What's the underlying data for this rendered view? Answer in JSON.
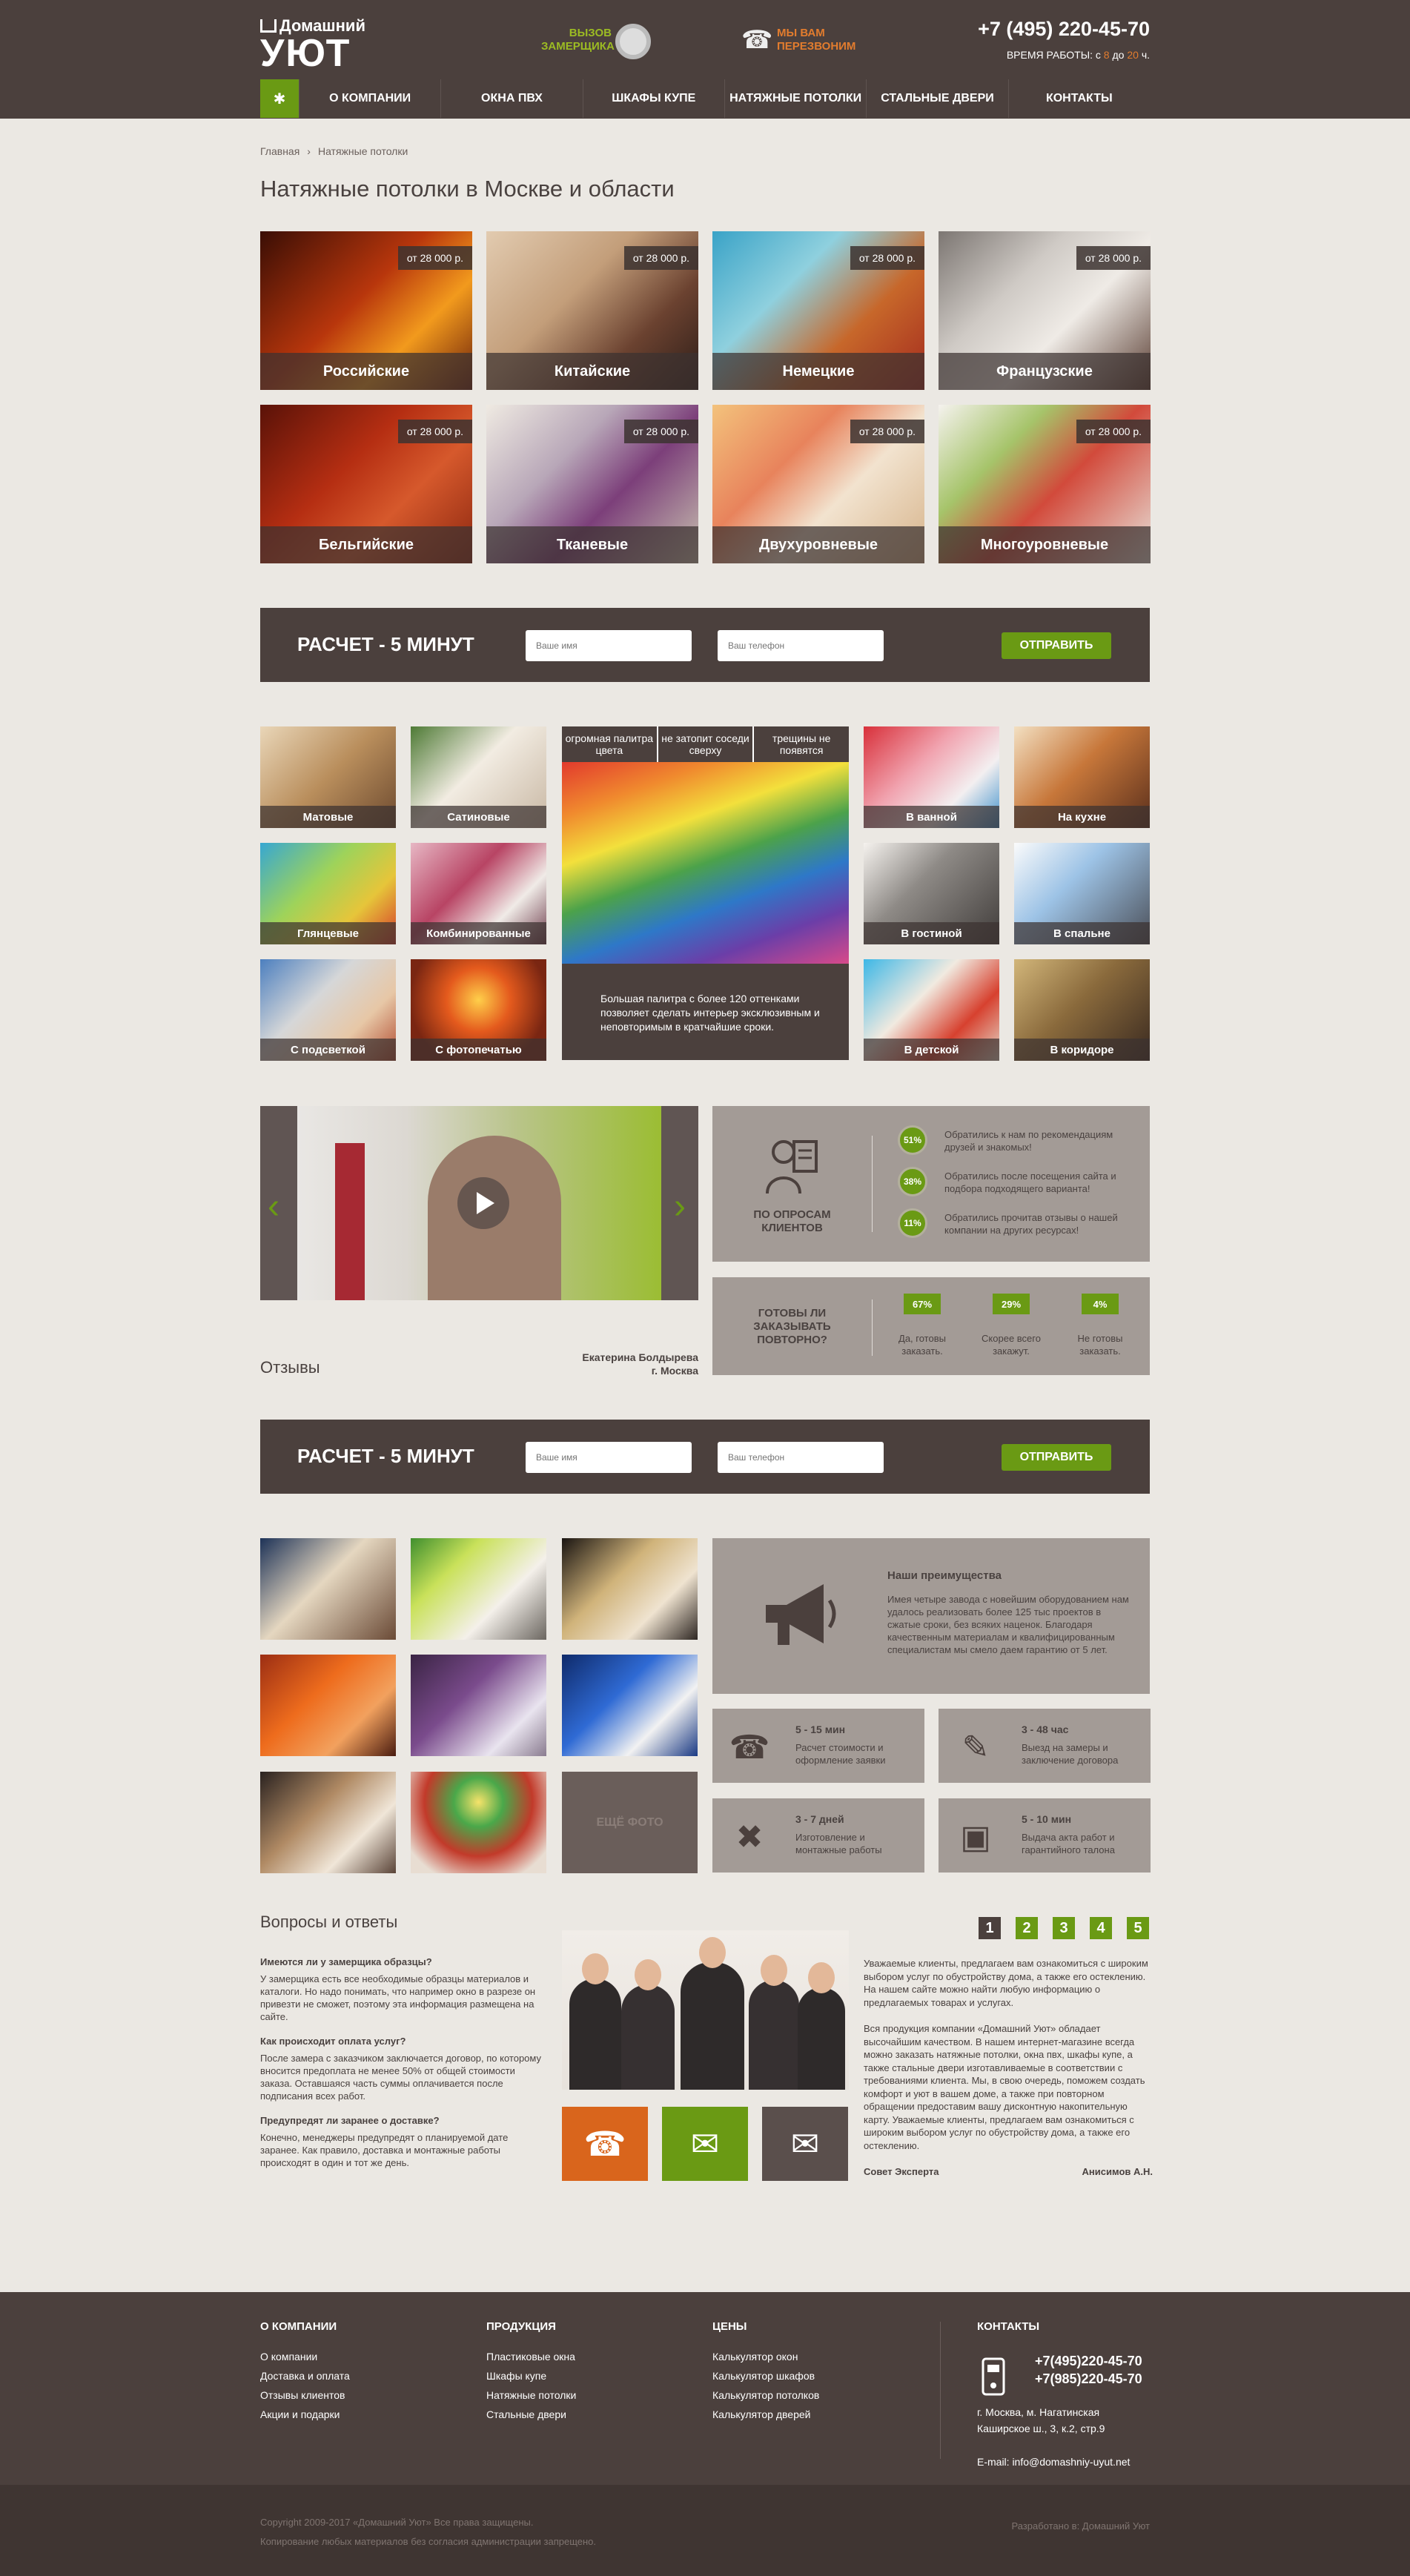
{
  "header": {
    "logo_small": "Домашний",
    "logo_big": "УЮТ",
    "measure_line1": "ВЫЗОВ",
    "measure_line2": "ЗАМЕРЩИКА",
    "callback_line1": "МЫ ВАМ",
    "callback_line2": "ПЕРЕЗВОНИМ",
    "phone": "+7 (495) 220-45-70",
    "hours_label": "ВРЕМЯ РАБОТЫ: с",
    "hours_from": "8",
    "hours_mid": "до",
    "hours_to": "20",
    "hours_suffix": "ч."
  },
  "nav": {
    "items": [
      "О КОМПАНИИ",
      "ОКНА ПВХ",
      "ШКАФЫ КУПЕ",
      "НАТЯЖНЫЕ ПОТОЛКИ",
      "СТАЛЬНЫЕ ДВЕРИ",
      "КОНТАКТЫ"
    ]
  },
  "breadcrumb": {
    "home": "Главная",
    "current": "Натяжные потолки"
  },
  "page_title": "Натяжные потолки в Москве и области",
  "products": [
    {
      "name": "Российские",
      "price": "от 28 000 р."
    },
    {
      "name": "Китайские",
      "price": "от 28 000 р."
    },
    {
      "name": "Немецкие",
      "price": "от 28 000 р."
    },
    {
      "name": "Французские",
      "price": "от 28 000 р."
    },
    {
      "name": "Бельгийские",
      "price": "от 28 000 р."
    },
    {
      "name": "Тканевые",
      "price": "от 28 000 р."
    },
    {
      "name": "Двухуровневые",
      "price": "от 28 000 р."
    },
    {
      "name": "Многоуровневые",
      "price": "от 28 000 р."
    }
  ],
  "calc": {
    "title": "РАСЧЕТ - 5 МИНУТ",
    "name_placeholder": "Ваше имя",
    "phone_placeholder": "Ваш телефон",
    "submit": "ОТПРАВИТЬ"
  },
  "types_left": [
    "Матовые",
    "Сатиновые",
    "Глянцевые",
    "Комбинированные",
    "С подсветкой",
    "С фотопечатью"
  ],
  "types_right": [
    "В ванной",
    "На кухне",
    "В гостиной",
    "В спальне",
    "В детской",
    "В коридоре"
  ],
  "feature": {
    "tabs": [
      "огромная палитра цвета",
      "не затопит соседи сверху",
      "трещины не появятся"
    ],
    "text": "Большая палитра с более 120 оттенками позволяет сделать интерьер эксклюзивным и неповторимым в кратчайшие сроки."
  },
  "reviews": {
    "title": "Отзывы",
    "author": "Екатерина Болдырева",
    "city": "г. Москва"
  },
  "survey": {
    "label": "ПО ОПРОСАМ КЛИЕНТОВ",
    "items": [
      {
        "pct": "51%",
        "text": "Обратились к нам по рекомендациям друзей и знакомых!"
      },
      {
        "pct": "38%",
        "text": "Обратились после посещения сайта и подбора подходящего варианта!"
      },
      {
        "pct": "11%",
        "text": "Обратились прочитав отзывы о нашей компании на других ресурсах!"
      }
    ],
    "repeat_label": "ГОТОВЫ ЛИ ЗАКАЗЫВАТЬ ПОВТОРНО?",
    "repeat": [
      {
        "pct": "67%",
        "text": "Да, готовы заказать."
      },
      {
        "pct": "29%",
        "text": "Скорее всего закажут."
      },
      {
        "pct": "4%",
        "text": "Не готовы заказать."
      }
    ]
  },
  "gallery": {
    "more": "ЕЩЁ ФОТО"
  },
  "advantages": {
    "title": "Наши преимущества",
    "text": "Имея четыре завода с новейшим оборудованием нам удалось реализовать более 125 тыс проектов в сжатые сроки, без всяких наценок. Благодаря качественным материалам и квалифицированным специалистам мы смело даем гарантию от 5 лет.",
    "items": [
      {
        "time": "5 - 15 мин",
        "text": "Расчет стоимости и оформление заявки"
      },
      {
        "time": "3 - 48 час",
        "text": "Выезд на замеры и заключение договора"
      },
      {
        "time": "3 - 7 дней",
        "text": "Изготовление и монтажные работы"
      },
      {
        "time": "5 - 10 мин",
        "text": "Выдача акта работ и гарантийного талона"
      }
    ]
  },
  "faq": {
    "title": "Вопросы и ответы",
    "items": [
      {
        "q": "Имеются ли у замерщика образцы?",
        "a": "У замерщика есть все необходимые образцы материалов и каталоги. Но надо понимать, что например окно в разрезе он привезти не сможет, поэтому эта информация размещена на сайте."
      },
      {
        "q": "Как происходит оплата услуг?",
        "a": "После замера с заказчиком заключается договор, по которому вносится предоплата не менее 50% от общей стоимости заказа. Оставшаяся часть суммы оплачивается после подписания всех работ."
      },
      {
        "q": "Предупредят ли заранее о доставке?",
        "a": "Конечно, менеджеры предупредят о планируемой дате заранее. Как правило, доставка и монтажные работы происходят в один и тот же день."
      }
    ],
    "pages": [
      "1",
      "2",
      "3",
      "4",
      "5"
    ]
  },
  "expert": {
    "p1": "Уважаемые клиенты, предлагаем вам ознакомиться с широким выбором услуг по обустройству дома, а также его остеклению. На нашем сайте можно найти любую информацию о предлагаемых товарах и услугах.",
    "p2": "Вся продукция компании «Домашний Уют» обладает высочайшим качеством. В нашем интернет-магазине всегда можно заказать натяжные потолки, окна пвх, шкафы купе, а также стальные двери изготавливаемые в соответствии с требованиями клиента. Мы, в свою очередь, поможем создать комфорт и уют в вашем доме, а также при повторном обращении предоставим вашу дисконтную накопительную карту. Уважаемые клиенты, предлагаем вам ознакомиться с широким выбором услуг по обустройству дома, а также его остеклению.",
    "label": "Совет Эксперта",
    "name": "Анисимов А.Н."
  },
  "footer": {
    "company": {
      "title": "О КОМПАНИИ",
      "links": [
        "О компании",
        "Доставка и оплата",
        "Отзывы клиентов",
        "Акции и подарки"
      ]
    },
    "products": {
      "title": "ПРОДУКЦИЯ",
      "links": [
        "Пластиковые окна",
        "Шкафы купе",
        "Натяжные потолки",
        "Стальные двери"
      ]
    },
    "prices": {
      "title": "ЦЕНЫ",
      "links": [
        "Калькулятор окон",
        "Калькулятор шкафов",
        "Калькулятор потолков",
        "Калькулятор дверей"
      ]
    },
    "contacts": {
      "title": "КОНТАКТЫ",
      "phone1": "+7(495)220-45-70",
      "phone2": "+7(985)220-45-70",
      "addr1": "г. Москва, м. Нагатинская",
      "addr2": "Каширское ш., 3, к.2, стр.9",
      "email": "E-mail: info@domashniy-uyut.net"
    },
    "copyright": "Copyright 2009-2017 «Домашний Уют» Все права защищены.",
    "copy_note": "Копирование любых материалов без согласия администрации запрещено.",
    "developer": "Разработано в: Домашний Уют"
  },
  "colors": {
    "brand_dark": "#4b403d",
    "accent_green": "#6a9a14",
    "accent_orange": "#e27c2e",
    "panel_grey": "#a39b96",
    "page_bg": "#ebe8e3"
  }
}
